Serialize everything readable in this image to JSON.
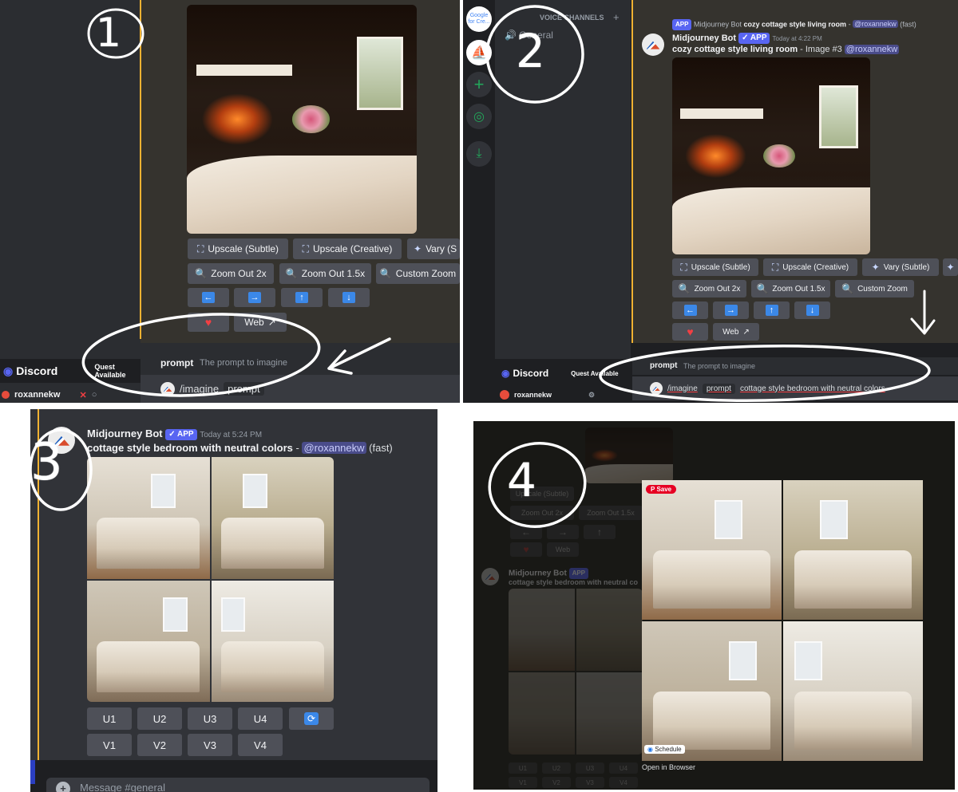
{
  "panels": {
    "one": {
      "number": "1",
      "buttons_row1": [
        "Upscale (Subtle)",
        "Upscale (Creative)",
        "Vary (S"
      ],
      "buttons_row2": [
        "Zoom Out 2x",
        "Zoom Out 1.5x",
        "Custom Zoom"
      ],
      "web_label": "Web",
      "prompt_hint_label": "prompt",
      "prompt_hint_desc": "The prompt to imagine",
      "command": "/imagine",
      "option_chip": "prompt",
      "discord_brand": "Discord",
      "quest": "Quest Available",
      "username": "roxannekw"
    },
    "two": {
      "number": "2",
      "channels_header": "VOICE CHANNELS",
      "voice_channel": "General",
      "reply_app": "APP",
      "reply_bot": "Midjourney Bot",
      "reply_text": "cozy cottage style living room",
      "reply_mention": "@roxannekw",
      "reply_suffix": "(fast)",
      "bot_name": "Midjourney Bot",
      "app_badge": "APP",
      "timestamp": "Today at 4:22 PM",
      "msg_bold": "cozy cottage style living room",
      "msg_rest": " - Image #3 ",
      "msg_mention": "@roxannekw",
      "buttons_row1": [
        "Upscale (Subtle)",
        "Upscale (Creative)",
        "Vary (Subtle)"
      ],
      "buttons_row2": [
        "Zoom Out 2x",
        "Zoom Out 1.5x",
        "Custom Zoom"
      ],
      "web_label": "Web",
      "prompt_hint_label": "prompt",
      "prompt_hint_desc": "The prompt to imagine",
      "command": "/imagine",
      "option_chip": "prompt",
      "typed_text": "cottage style bedroom with neutral colors",
      "discord_brand": "Discord",
      "quest": "Quest Available",
      "username": "roxannekw",
      "server_label": "Google for Cre..."
    },
    "three": {
      "number": "3",
      "bot_name": "Midjourney Bot",
      "app_badge": "APP",
      "timestamp": "Today at 5:24 PM",
      "msg_bold": "cottage style bedroom with neutral colors",
      "msg_sep": " - ",
      "msg_mention": "@roxannekw",
      "msg_suffix": " (fast)",
      "u_buttons": [
        "U1",
        "U2",
        "U3",
        "U4"
      ],
      "v_buttons": [
        "V1",
        "V2",
        "V3",
        "V4"
      ],
      "message_placeholder": "Message #general"
    },
    "four": {
      "number": "4",
      "save_label": "Save",
      "schedule_label": "Schedule",
      "open_in_browser": "Open in Browser",
      "bot_name": "Midjourney Bot",
      "app_badge": "APP",
      "msg_bold": "cottage style bedroom with neutral co",
      "bg_buttons_row1": [
        "Upscale (Subtle)"
      ],
      "bg_buttons_row2": [
        "Zoom Out 2x",
        "Zoom Out 1.5x"
      ],
      "web_label": "Web",
      "u_buttons": [
        "U1",
        "U2",
        "U3",
        "U4"
      ],
      "v_buttons": [
        "V1",
        "V2",
        "V3",
        "V4"
      ]
    }
  },
  "colors": {
    "blurple": "#5865f2",
    "button": "#4e5058",
    "arrow_blue": "#3b88e8",
    "accent_gold": "#f0b232",
    "pinterest_red": "#e60023"
  }
}
